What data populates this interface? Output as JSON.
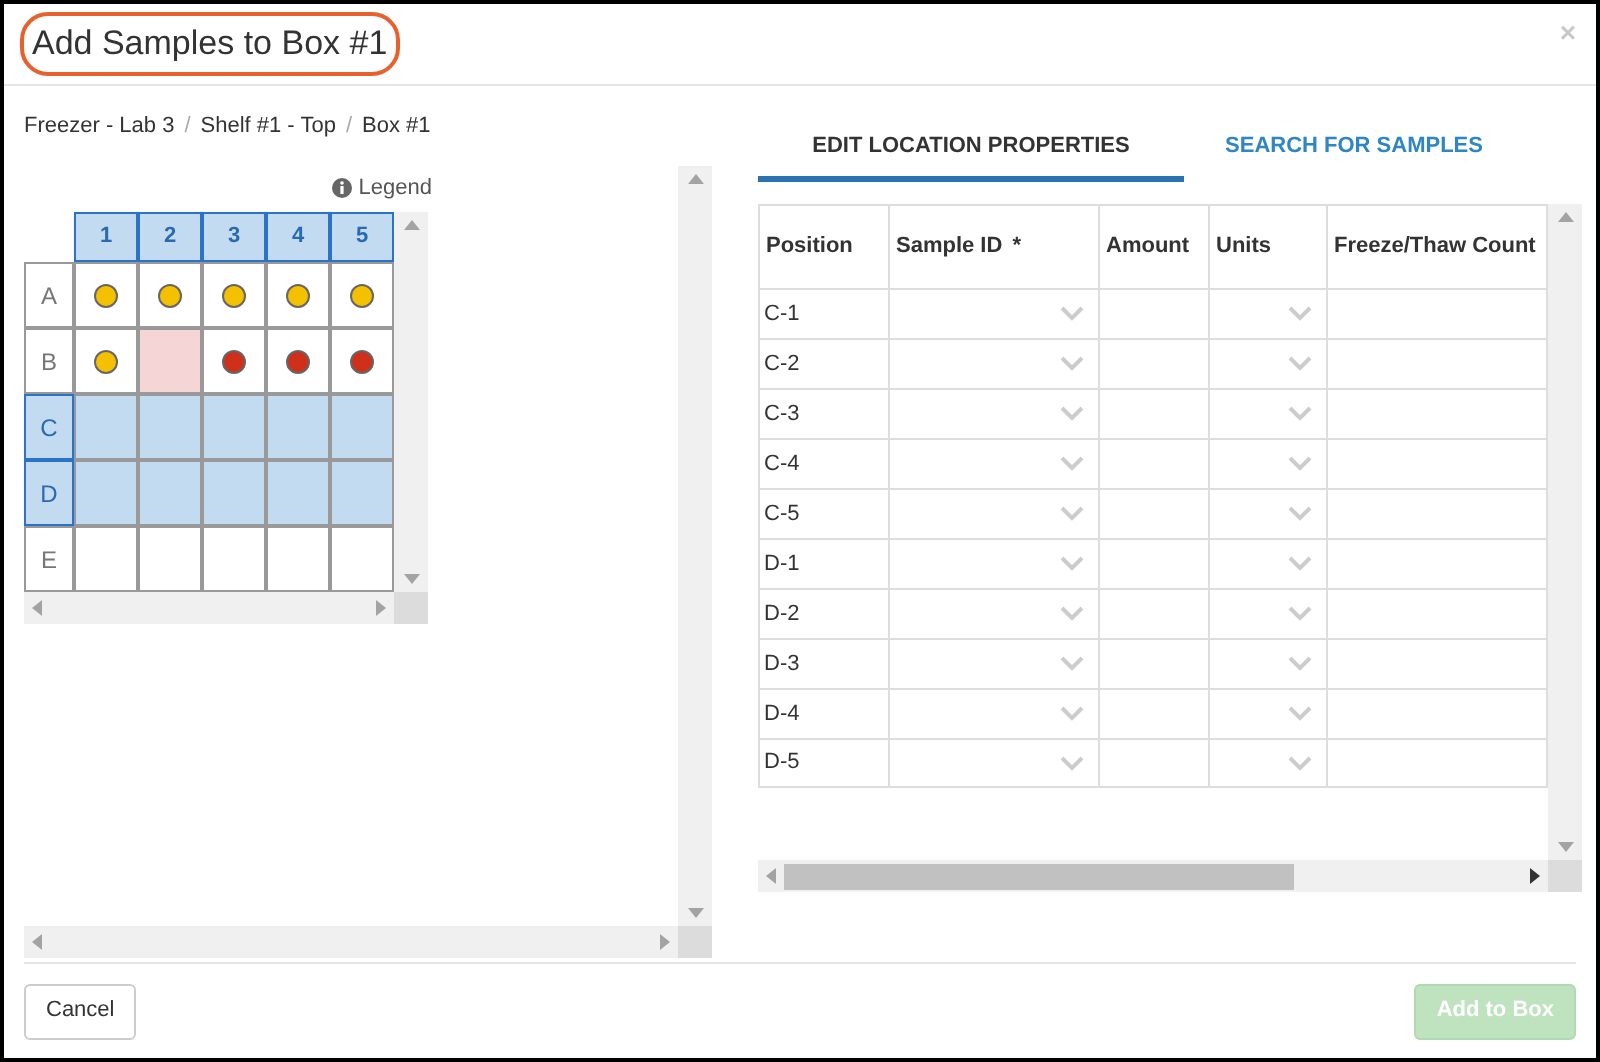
{
  "dialog": {
    "title": "Add Samples to Box #1",
    "title_highlighted": true,
    "close": "×"
  },
  "breadcrumb": [
    "Freezer - Lab 3",
    "Shelf #1 - Top",
    "Box #1"
  ],
  "breadcrumb_separator": "/",
  "legend": {
    "label": "Legend"
  },
  "grid": {
    "columns": [
      {
        "label": "1",
        "selected": true
      },
      {
        "label": "2",
        "selected": true
      },
      {
        "label": "3",
        "selected": true
      },
      {
        "label": "4",
        "selected": true
      },
      {
        "label": "5",
        "selected": true
      }
    ],
    "rows": [
      {
        "label": "A",
        "selected": false,
        "cells": [
          {
            "kind": "sample",
            "color": "#f5c000"
          },
          {
            "kind": "sample",
            "color": "#f5c000"
          },
          {
            "kind": "sample",
            "color": "#f5c000"
          },
          {
            "kind": "sample",
            "color": "#f5c000"
          },
          {
            "kind": "sample",
            "color": "#f5c000"
          }
        ]
      },
      {
        "label": "B",
        "selected": false,
        "cells": [
          {
            "kind": "sample",
            "color": "#f5c000"
          },
          {
            "kind": "pending"
          },
          {
            "kind": "sample",
            "color": "#d0301a"
          },
          {
            "kind": "sample",
            "color": "#d0301a"
          },
          {
            "kind": "sample",
            "color": "#d0301a"
          }
        ]
      },
      {
        "label": "C",
        "selected": true,
        "cells": [
          {
            "kind": "empty"
          },
          {
            "kind": "empty"
          },
          {
            "kind": "empty"
          },
          {
            "kind": "empty"
          },
          {
            "kind": "empty"
          }
        ]
      },
      {
        "label": "D",
        "selected": true,
        "cells": [
          {
            "kind": "empty"
          },
          {
            "kind": "empty"
          },
          {
            "kind": "empty"
          },
          {
            "kind": "empty"
          },
          {
            "kind": "empty"
          }
        ]
      },
      {
        "label": "E",
        "selected": false,
        "cells": [
          {
            "kind": "empty"
          },
          {
            "kind": "empty"
          },
          {
            "kind": "empty"
          },
          {
            "kind": "empty"
          },
          {
            "kind": "empty"
          }
        ]
      }
    ]
  },
  "tabs": [
    {
      "label": "EDIT LOCATION PROPERTIES",
      "selected": true
    },
    {
      "label": "SEARCH FOR SAMPLES",
      "selected": false
    }
  ],
  "table": {
    "columns": [
      {
        "label": "Position",
        "kind": "label"
      },
      {
        "label": "Sample ID",
        "required_mark": "*",
        "kind": "select"
      },
      {
        "label": "Amount",
        "kind": "text"
      },
      {
        "label": "Units",
        "kind": "select"
      },
      {
        "label": "Freeze/Thaw Count",
        "kind": "text"
      }
    ],
    "rows": [
      "C-1",
      "C-2",
      "C-3",
      "C-4",
      "C-5",
      "D-1",
      "D-2",
      "D-3",
      "D-4",
      "D-5"
    ]
  },
  "buttons": [
    {
      "label": "Cancel",
      "kind": "secondary",
      "disabled": false
    },
    {
      "label": "Add to Box",
      "kind": "primary",
      "disabled": true
    }
  ]
}
